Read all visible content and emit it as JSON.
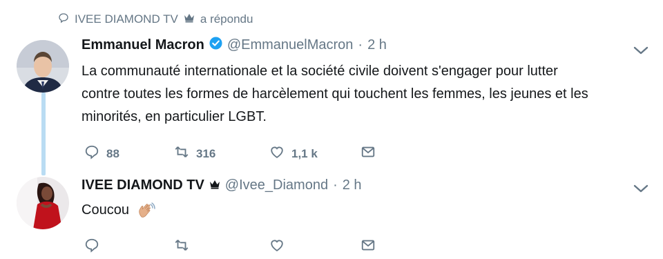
{
  "context": {
    "name": "IVEE DIAMOND TV",
    "replied": "a répondu"
  },
  "tweet1": {
    "name": "Emmanuel Macron",
    "handle": "@EmmanuelMacron",
    "dot": "·",
    "time": "2 h",
    "text_lines": [
      "La communauté internationale et la société civile doivent s'engager pour lutter",
      "contre toutes les formes de harcèlement qui touchent les femmes, les jeunes et les",
      "minorités, en particulier LGBT."
    ],
    "replies": "88",
    "retweets": "316",
    "likes": "1,1 k"
  },
  "tweet2": {
    "name": "IVEE DIAMOND TV",
    "handle": "@Ivee_Diamond",
    "dot": "·",
    "time": "2 h",
    "text": "Coucou",
    "emoji": "waving-hand"
  },
  "colors": {
    "text_primary": "#14171a",
    "text_secondary": "#657786",
    "verified": "#1da1f2",
    "thread_line": "#b9dcf3"
  },
  "icons": [
    "speech-bubble-icon",
    "crown-icon",
    "verified-badge-icon",
    "chevron-down-icon",
    "reply-icon",
    "retweet-icon",
    "like-icon",
    "message-icon"
  ]
}
